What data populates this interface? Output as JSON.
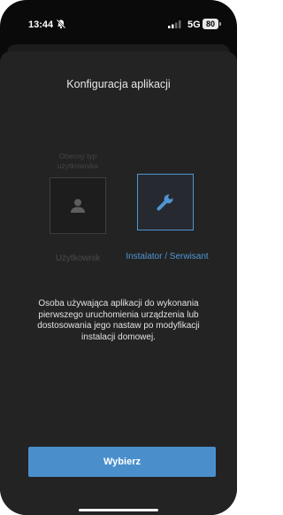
{
  "status_bar": {
    "time": "13:44",
    "network": "5G",
    "battery": "80",
    "icons": [
      "bell-off-icon",
      "signal-icon"
    ]
  },
  "screen": {
    "title": "Konfiguracja aplikacji",
    "current_type_label": "Obecny typ użytkownika",
    "options": [
      {
        "label": "Użytkownik",
        "icon": "person-icon",
        "selected": false
      },
      {
        "label": "Instalator / Serwisant",
        "icon": "wrench-icon",
        "selected": true
      }
    ],
    "description": "Osoba używająca aplikacji do wykonania pierwszego uruchomienia urządzenia lub dostosowania jego nastaw po modyfikacji instalacji domowej.",
    "select_button": "Wybierz"
  },
  "colors": {
    "accent": "#4a8fcc",
    "selected_label": "#4f95d3",
    "sheet_background": "#232323",
    "disabled_text": "#4a4a4a"
  }
}
